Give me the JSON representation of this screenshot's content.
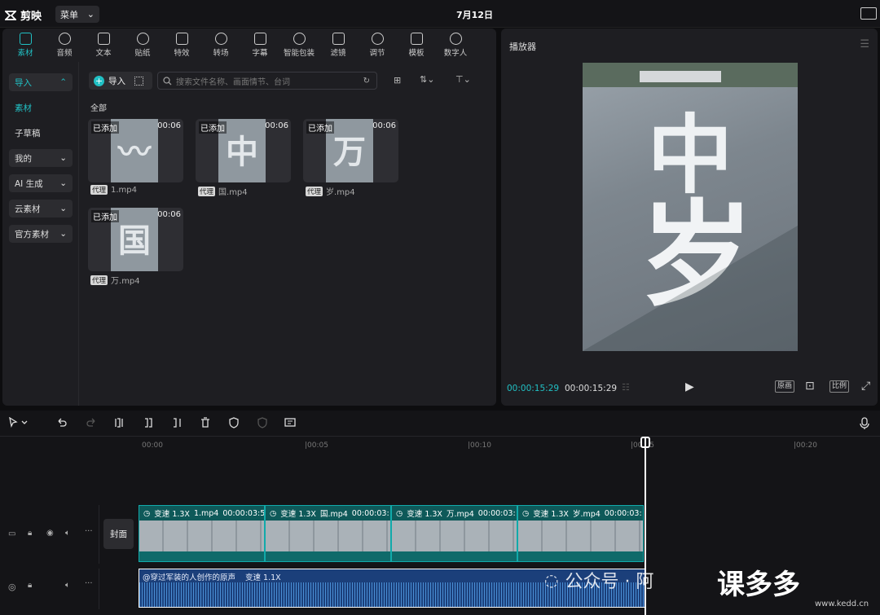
{
  "app": {
    "name": "剪映",
    "menu_label": "菜单",
    "date": "7月12日"
  },
  "media_tabs": [
    {
      "label": "素材",
      "icon": "media-play-icon",
      "active": true
    },
    {
      "label": "音频",
      "icon": "audio-icon"
    },
    {
      "label": "文本",
      "icon": "text-icon"
    },
    {
      "label": "贴纸",
      "icon": "sticker-icon"
    },
    {
      "label": "特效",
      "icon": "effect-icon"
    },
    {
      "label": "转场",
      "icon": "transition-icon"
    },
    {
      "label": "字幕",
      "icon": "subtitle-icon"
    },
    {
      "label": "智能包装",
      "icon": "smart-pack-icon"
    },
    {
      "label": "滤镜",
      "icon": "filter-icon"
    },
    {
      "label": "调节",
      "icon": "adjust-icon"
    },
    {
      "label": "模板",
      "icon": "template-icon"
    },
    {
      "label": "数字人",
      "icon": "digital-human-icon"
    }
  ],
  "sidenav": [
    {
      "label": "导入",
      "expanded": true
    },
    {
      "label": "素材",
      "selected": true
    },
    {
      "label": "子草稿"
    },
    {
      "label": "我的"
    },
    {
      "label": "AI 生成"
    },
    {
      "label": "云素材"
    },
    {
      "label": "官方素材"
    }
  ],
  "library": {
    "import_label": "导入",
    "search_placeholder": "搜索文件名称、画面情节、台词",
    "all_label": "全部",
    "clips": [
      {
        "added": "已添加",
        "duration": "00:06",
        "tag": "代理",
        "name": "1.mp4",
        "glyph": "〰"
      },
      {
        "added": "已添加",
        "duration": "00:06",
        "tag": "代理",
        "name": "国.mp4",
        "glyph": "中"
      },
      {
        "added": "已添加",
        "duration": "00:06",
        "tag": "代理",
        "name": "岁.mp4",
        "glyph": "万"
      },
      {
        "added": "已添加",
        "duration": "00:06",
        "tag": "代理",
        "name": "万.mp4",
        "glyph": "国"
      }
    ]
  },
  "player": {
    "title": "播放器",
    "current_time": "00:00:15:29",
    "total_time": "00:00:15:29",
    "original_label": "原画",
    "ratio_label": "比例",
    "frame_glyphs": [
      "中",
      "岁"
    ]
  },
  "timeline": {
    "ruler": [
      "00:00",
      "|00:05",
      "|00:10",
      "|00:15",
      "|00:20"
    ],
    "cover_label": "封面",
    "video_clips": [
      {
        "speed": "变速 1.3X",
        "name": "1.mp4",
        "time": "00:00:03:5"
      },
      {
        "speed": "变速 1.3X",
        "name": "国.mp4",
        "time": "00:00:03:"
      },
      {
        "speed": "变速 1.3X",
        "name": "万.mp4",
        "time": "00:00:03:"
      },
      {
        "speed": "变速 1.3X",
        "name": "岁.mp4",
        "time": "00:00:03:"
      }
    ],
    "audio": {
      "name": "@穿过军装的人创作的原声",
      "speed": "变速 1.1X"
    }
  },
  "watermark": {
    "text": "公众号 · 阿",
    "brand": "课多多",
    "url": "www.kedd.cn"
  },
  "colors": {
    "accent": "#21c0c4",
    "video_track": "#0f6a6a",
    "audio_track": "#1b3f7a"
  }
}
